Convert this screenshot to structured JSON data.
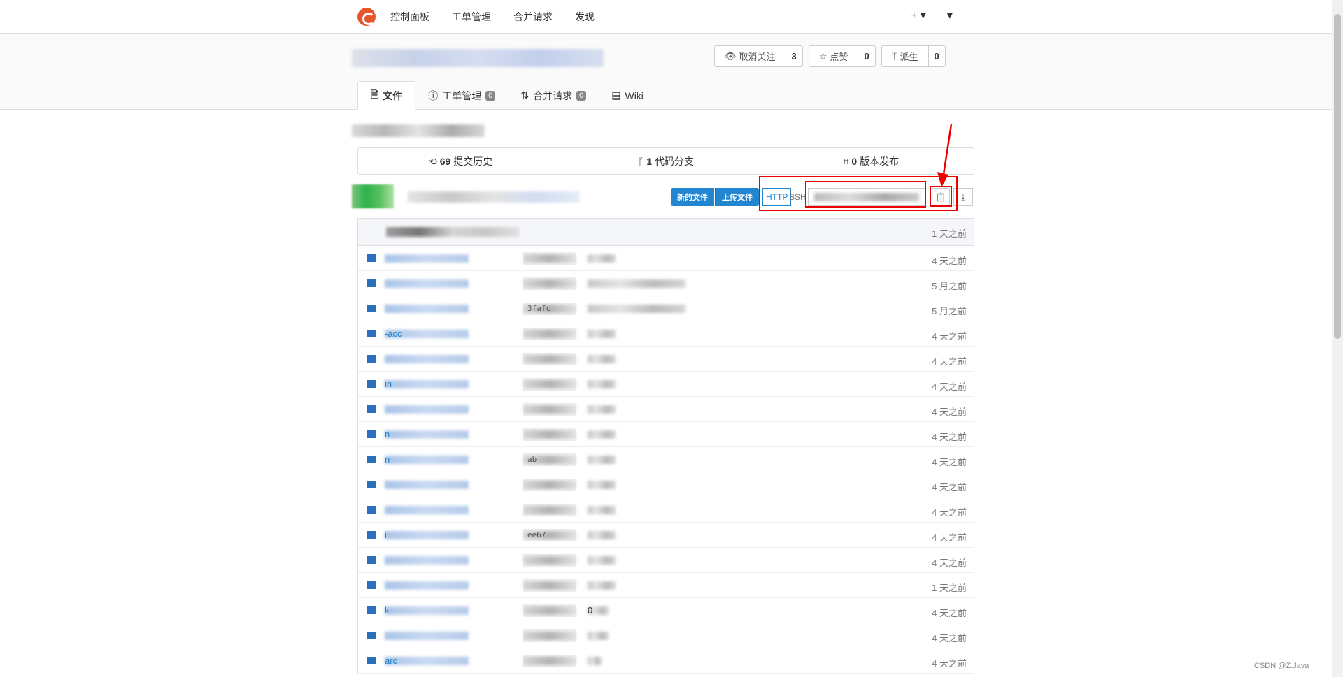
{
  "topnav": {
    "items": [
      "控制面板",
      "工单管理",
      "合并请求",
      "发现"
    ],
    "plus": "+ ▾",
    "menu": "▾"
  },
  "repo": {
    "unwatch_label": "取消关注",
    "unwatch_count": "3",
    "star_label": "点赞",
    "star_count": "0",
    "fork_label": "派生",
    "fork_count": "0"
  },
  "tabs": [
    {
      "label": "文件"
    },
    {
      "label": "工单管理",
      "badge": "0"
    },
    {
      "label": "合并请求",
      "badge": "0"
    },
    {
      "label": "Wiki"
    }
  ],
  "stats": {
    "commits_count": "69",
    "commits_label": "提交历史",
    "branches_count": "1",
    "branches_label": "代码分支",
    "releases_count": "0",
    "releases_label": "版本发布"
  },
  "toolbar": {
    "new_file": "新的文件",
    "upload_file": "上传文件",
    "http": "HTTP",
    "ssh": "SSH"
  },
  "latest_commit": {
    "age": "1 天之前"
  },
  "files": [
    {
      "name": "",
      "sha": "",
      "msg": "",
      "age": "4 天之前"
    },
    {
      "name": "",
      "sha": "",
      "msg": "",
      "age": "5 月之前"
    },
    {
      "name": "",
      "sha": "3fafc",
      "msg": "",
      "age": "5 月之前"
    },
    {
      "name": "-acc",
      "sha": "",
      "msg": "",
      "age": "4 天之前"
    },
    {
      "name": "",
      "sha": "",
      "msg": "",
      "age": "4 天之前"
    },
    {
      "name": "in",
      "sha": "",
      "msg": "",
      "age": "4 天之前"
    },
    {
      "name": "",
      "sha": "",
      "msg": "",
      "age": "4 天之前"
    },
    {
      "name": "n-",
      "sha": "",
      "msg": "",
      "age": "4 天之前"
    },
    {
      "name": "n-",
      "sha": "ab",
      "msg": "",
      "age": "4 天之前"
    },
    {
      "name": "",
      "sha": "",
      "msg": "",
      "age": "4 天之前"
    },
    {
      "name": "",
      "sha": "",
      "msg": "",
      "age": "4 天之前"
    },
    {
      "name": "i",
      "sha": "ee67",
      "msg": "",
      "age": "4 天之前"
    },
    {
      "name": "",
      "sha": "",
      "msg": "",
      "age": "4 天之前"
    },
    {
      "name": "",
      "sha": "",
      "msg": "",
      "age": "1 天之前"
    },
    {
      "name": "k",
      "sha": "",
      "msg": "0",
      "age": "4 天之前"
    },
    {
      "name": "",
      "sha": "",
      "msg": "",
      "age": "4 天之前"
    },
    {
      "name": "arc",
      "sha": "",
      "msg": "",
      "age": "4 天之前"
    }
  ],
  "watermark": "CSDN @Z.Java",
  "colors": {
    "primary": "#2185d0",
    "logo": "#e5562d",
    "highlight": "#e00000"
  }
}
